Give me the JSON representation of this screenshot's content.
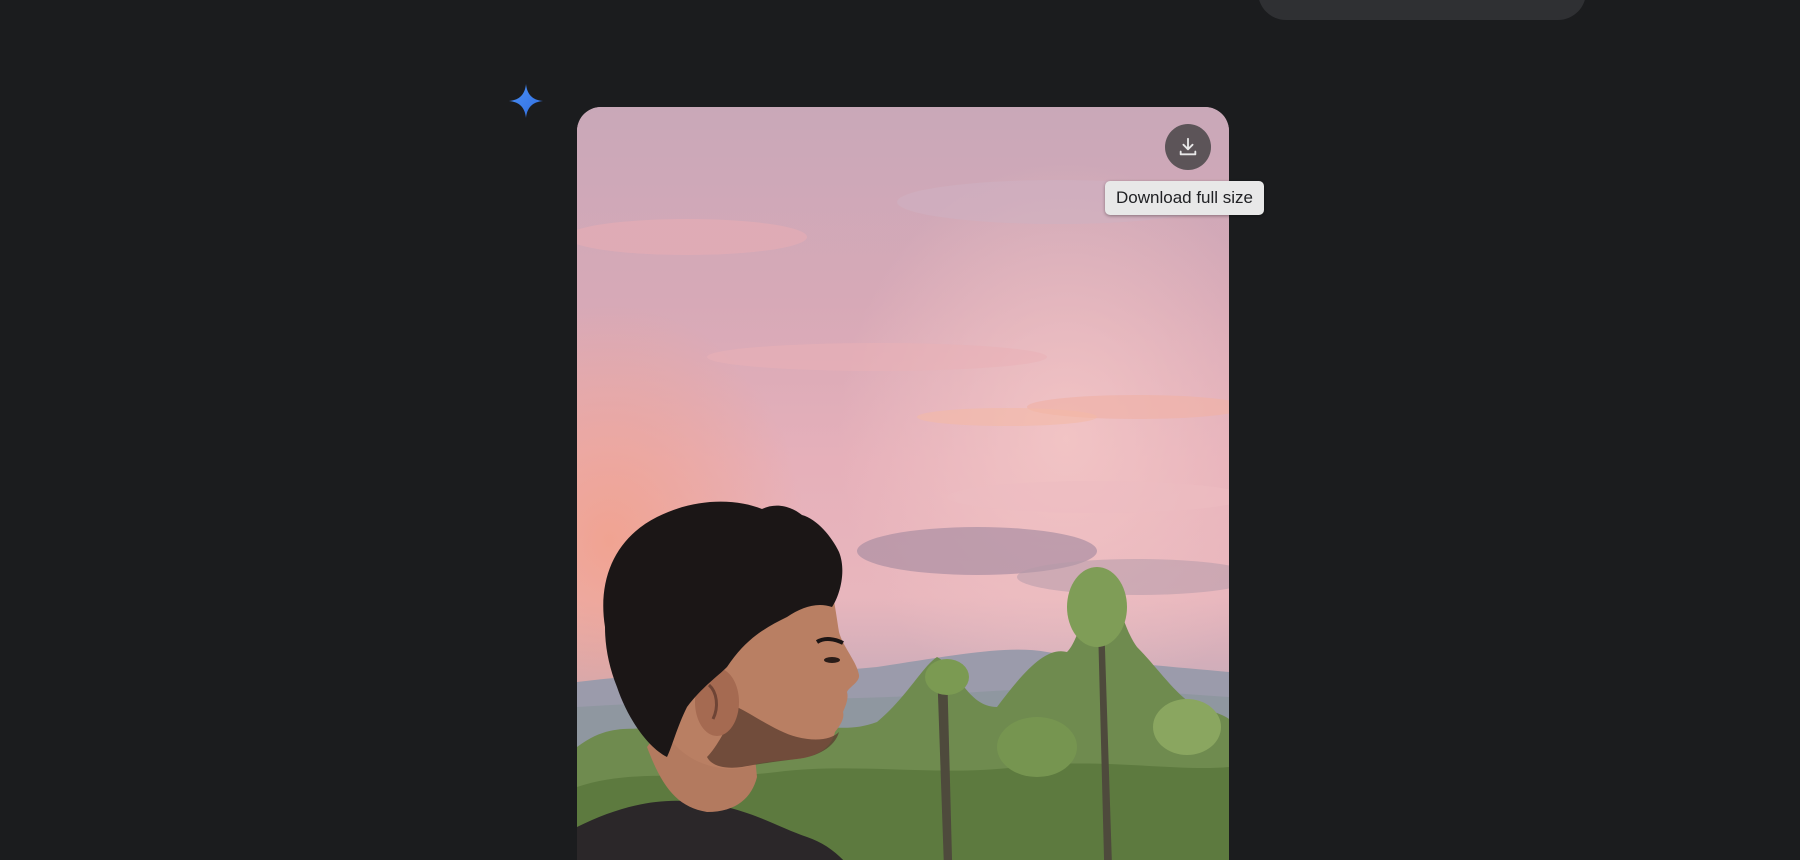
{
  "response": {
    "avatar_icon": "gemini-sparkle-icon",
    "image": {
      "subject": "portrait-photo",
      "download_button_icon": "download-icon",
      "download_tooltip": "Download full size"
    }
  },
  "colors": {
    "background": "#1b1c1e",
    "prompt_bubble": "#2f3033",
    "sparkle_blue": "#4285f4",
    "tooltip_bg": "#e8e8e8"
  }
}
